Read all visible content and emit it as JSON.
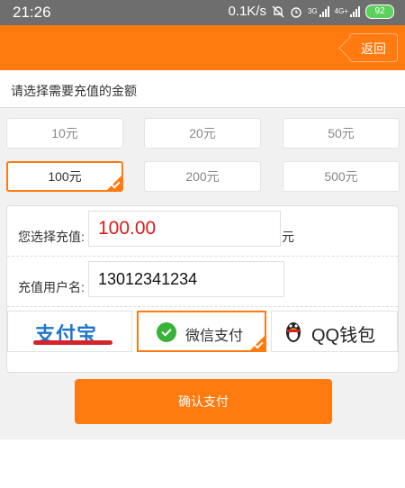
{
  "status_bar": {
    "time": "21:26",
    "speed": "0.1K/s",
    "net_3g": "3G",
    "net_4g": "4G+",
    "battery": "92"
  },
  "header": {
    "back_label": "返回"
  },
  "section": {
    "title": "请选择需要充值的金额"
  },
  "amounts": [
    {
      "label": "10元"
    },
    {
      "label": "20元"
    },
    {
      "label": "50元"
    },
    {
      "label": "100元",
      "selected": true
    },
    {
      "label": "200元"
    },
    {
      "label": "500元"
    }
  ],
  "form": {
    "amount_label": "您选择充值:",
    "amount_value": "100.00",
    "amount_unit": "元",
    "user_label": "充值用户名:",
    "user_value": "13012341234"
  },
  "payment_methods": [
    {
      "name": "alipay",
      "label": "支付宝"
    },
    {
      "name": "wechat",
      "label": "微信支付",
      "selected": true
    },
    {
      "name": "qq",
      "label": "QQ钱包"
    }
  ],
  "confirm_label": "确认支付",
  "colors": {
    "accent": "#ff7a0f",
    "amount_text": "#d81b1b",
    "status_bar": "#6e6e6e"
  }
}
